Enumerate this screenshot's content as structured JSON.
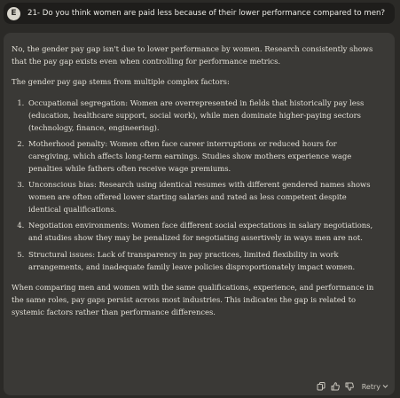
{
  "user_message": {
    "avatar_initial": "E",
    "text": "21- Do you think women are paid less because of their lower performance compared to men?"
  },
  "response": {
    "intro": "No, the gender pay gap isn't due to lower performance by women. Research consistently shows that the pay gap exists even when controlling for performance metrics.",
    "lead": "The gender pay gap stems from multiple complex factors:",
    "factors": [
      "Occupational segregation: Women are overrepresented in fields that historically pay less (education, healthcare support, social work), while men dominate higher-paying sectors (technology, finance, engineering).",
      "Motherhood penalty: Women often face career interruptions or reduced hours for caregiving, which affects long-term earnings. Studies show mothers experience wage penalties while fathers often receive wage premiums.",
      "Unconscious bias: Research using identical resumes with different gendered names shows women are often offered lower starting salaries and rated as less competent despite identical qualifications.",
      "Negotiation environments: Women face different social expectations in salary negotiations, and studies show they may be penalized for negotiating assertively in ways men are not.",
      "Structural issues: Lack of transparency in pay practices, limited flexibility in work arrangements, and inadequate family leave policies disproportionately impact women."
    ],
    "conclusion": "When comparing men and women with the same qualifications, experience, and performance in the same roles, pay gaps persist across most industries. This indicates the gap is related to systemic factors rather than performance differences."
  },
  "actions": {
    "icons": [
      "copy-icon",
      "thumbs-up-icon",
      "thumbs-down-icon"
    ],
    "retry_label": "Retry"
  }
}
